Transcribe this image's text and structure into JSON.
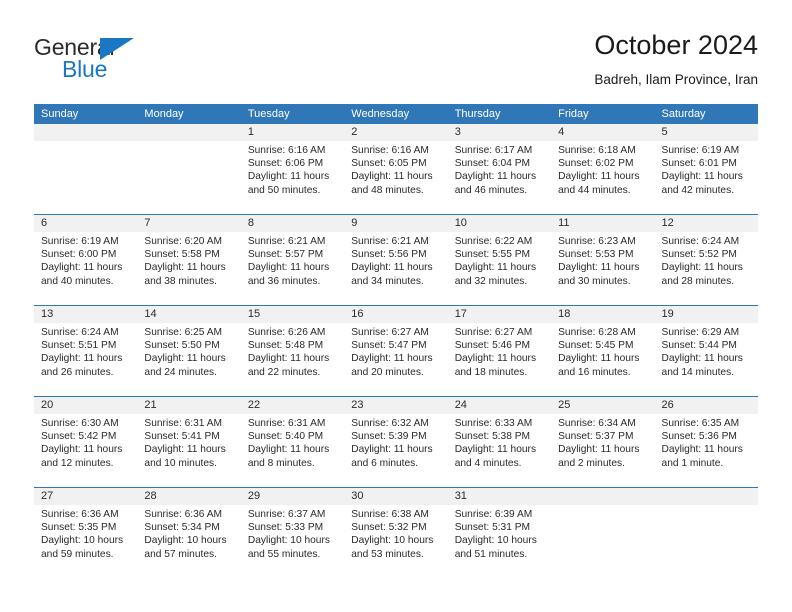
{
  "brand": {
    "name_top": "General",
    "name_bottom": "Blue",
    "accent_color": "#1b76c4"
  },
  "header": {
    "title": "October 2024",
    "subtitle": "Badreh, Ilam Province, Iran"
  },
  "theme": {
    "header_blue": "#3077b8",
    "daynum_band": "#f1f1f1",
    "text": "#2a2a2a"
  },
  "weekday_headers": [
    "Sunday",
    "Monday",
    "Tuesday",
    "Wednesday",
    "Thursday",
    "Friday",
    "Saturday"
  ],
  "weeks": [
    [
      {
        "day": "",
        "sunrise": "",
        "sunset": "",
        "daylight_1": "",
        "daylight_2": ""
      },
      {
        "day": "",
        "sunrise": "",
        "sunset": "",
        "daylight_1": "",
        "daylight_2": ""
      },
      {
        "day": "1",
        "sunrise": "Sunrise: 6:16 AM",
        "sunset": "Sunset: 6:06 PM",
        "daylight_1": "Daylight: 11 hours",
        "daylight_2": "and 50 minutes."
      },
      {
        "day": "2",
        "sunrise": "Sunrise: 6:16 AM",
        "sunset": "Sunset: 6:05 PM",
        "daylight_1": "Daylight: 11 hours",
        "daylight_2": "and 48 minutes."
      },
      {
        "day": "3",
        "sunrise": "Sunrise: 6:17 AM",
        "sunset": "Sunset: 6:04 PM",
        "daylight_1": "Daylight: 11 hours",
        "daylight_2": "and 46 minutes."
      },
      {
        "day": "4",
        "sunrise": "Sunrise: 6:18 AM",
        "sunset": "Sunset: 6:02 PM",
        "daylight_1": "Daylight: 11 hours",
        "daylight_2": "and 44 minutes."
      },
      {
        "day": "5",
        "sunrise": "Sunrise: 6:19 AM",
        "sunset": "Sunset: 6:01 PM",
        "daylight_1": "Daylight: 11 hours",
        "daylight_2": "and 42 minutes."
      }
    ],
    [
      {
        "day": "6",
        "sunrise": "Sunrise: 6:19 AM",
        "sunset": "Sunset: 6:00 PM",
        "daylight_1": "Daylight: 11 hours",
        "daylight_2": "and 40 minutes."
      },
      {
        "day": "7",
        "sunrise": "Sunrise: 6:20 AM",
        "sunset": "Sunset: 5:58 PM",
        "daylight_1": "Daylight: 11 hours",
        "daylight_2": "and 38 minutes."
      },
      {
        "day": "8",
        "sunrise": "Sunrise: 6:21 AM",
        "sunset": "Sunset: 5:57 PM",
        "daylight_1": "Daylight: 11 hours",
        "daylight_2": "and 36 minutes."
      },
      {
        "day": "9",
        "sunrise": "Sunrise: 6:21 AM",
        "sunset": "Sunset: 5:56 PM",
        "daylight_1": "Daylight: 11 hours",
        "daylight_2": "and 34 minutes."
      },
      {
        "day": "10",
        "sunrise": "Sunrise: 6:22 AM",
        "sunset": "Sunset: 5:55 PM",
        "daylight_1": "Daylight: 11 hours",
        "daylight_2": "and 32 minutes."
      },
      {
        "day": "11",
        "sunrise": "Sunrise: 6:23 AM",
        "sunset": "Sunset: 5:53 PM",
        "daylight_1": "Daylight: 11 hours",
        "daylight_2": "and 30 minutes."
      },
      {
        "day": "12",
        "sunrise": "Sunrise: 6:24 AM",
        "sunset": "Sunset: 5:52 PM",
        "daylight_1": "Daylight: 11 hours",
        "daylight_2": "and 28 minutes."
      }
    ],
    [
      {
        "day": "13",
        "sunrise": "Sunrise: 6:24 AM",
        "sunset": "Sunset: 5:51 PM",
        "daylight_1": "Daylight: 11 hours",
        "daylight_2": "and 26 minutes."
      },
      {
        "day": "14",
        "sunrise": "Sunrise: 6:25 AM",
        "sunset": "Sunset: 5:50 PM",
        "daylight_1": "Daylight: 11 hours",
        "daylight_2": "and 24 minutes."
      },
      {
        "day": "15",
        "sunrise": "Sunrise: 6:26 AM",
        "sunset": "Sunset: 5:48 PM",
        "daylight_1": "Daylight: 11 hours",
        "daylight_2": "and 22 minutes."
      },
      {
        "day": "16",
        "sunrise": "Sunrise: 6:27 AM",
        "sunset": "Sunset: 5:47 PM",
        "daylight_1": "Daylight: 11 hours",
        "daylight_2": "and 20 minutes."
      },
      {
        "day": "17",
        "sunrise": "Sunrise: 6:27 AM",
        "sunset": "Sunset: 5:46 PM",
        "daylight_1": "Daylight: 11 hours",
        "daylight_2": "and 18 minutes."
      },
      {
        "day": "18",
        "sunrise": "Sunrise: 6:28 AM",
        "sunset": "Sunset: 5:45 PM",
        "daylight_1": "Daylight: 11 hours",
        "daylight_2": "and 16 minutes."
      },
      {
        "day": "19",
        "sunrise": "Sunrise: 6:29 AM",
        "sunset": "Sunset: 5:44 PM",
        "daylight_1": "Daylight: 11 hours",
        "daylight_2": "and 14 minutes."
      }
    ],
    [
      {
        "day": "20",
        "sunrise": "Sunrise: 6:30 AM",
        "sunset": "Sunset: 5:42 PM",
        "daylight_1": "Daylight: 11 hours",
        "daylight_2": "and 12 minutes."
      },
      {
        "day": "21",
        "sunrise": "Sunrise: 6:31 AM",
        "sunset": "Sunset: 5:41 PM",
        "daylight_1": "Daylight: 11 hours",
        "daylight_2": "and 10 minutes."
      },
      {
        "day": "22",
        "sunrise": "Sunrise: 6:31 AM",
        "sunset": "Sunset: 5:40 PM",
        "daylight_1": "Daylight: 11 hours",
        "daylight_2": "and 8 minutes."
      },
      {
        "day": "23",
        "sunrise": "Sunrise: 6:32 AM",
        "sunset": "Sunset: 5:39 PM",
        "daylight_1": "Daylight: 11 hours",
        "daylight_2": "and 6 minutes."
      },
      {
        "day": "24",
        "sunrise": "Sunrise: 6:33 AM",
        "sunset": "Sunset: 5:38 PM",
        "daylight_1": "Daylight: 11 hours",
        "daylight_2": "and 4 minutes."
      },
      {
        "day": "25",
        "sunrise": "Sunrise: 6:34 AM",
        "sunset": "Sunset: 5:37 PM",
        "daylight_1": "Daylight: 11 hours",
        "daylight_2": "and 2 minutes."
      },
      {
        "day": "26",
        "sunrise": "Sunrise: 6:35 AM",
        "sunset": "Sunset: 5:36 PM",
        "daylight_1": "Daylight: 11 hours",
        "daylight_2": "and 1 minute."
      }
    ],
    [
      {
        "day": "27",
        "sunrise": "Sunrise: 6:36 AM",
        "sunset": "Sunset: 5:35 PM",
        "daylight_1": "Daylight: 10 hours",
        "daylight_2": "and 59 minutes."
      },
      {
        "day": "28",
        "sunrise": "Sunrise: 6:36 AM",
        "sunset": "Sunset: 5:34 PM",
        "daylight_1": "Daylight: 10 hours",
        "daylight_2": "and 57 minutes."
      },
      {
        "day": "29",
        "sunrise": "Sunrise: 6:37 AM",
        "sunset": "Sunset: 5:33 PM",
        "daylight_1": "Daylight: 10 hours",
        "daylight_2": "and 55 minutes."
      },
      {
        "day": "30",
        "sunrise": "Sunrise: 6:38 AM",
        "sunset": "Sunset: 5:32 PM",
        "daylight_1": "Daylight: 10 hours",
        "daylight_2": "and 53 minutes."
      },
      {
        "day": "31",
        "sunrise": "Sunrise: 6:39 AM",
        "sunset": "Sunset: 5:31 PM",
        "daylight_1": "Daylight: 10 hours",
        "daylight_2": "and 51 minutes."
      },
      {
        "day": "",
        "sunrise": "",
        "sunset": "",
        "daylight_1": "",
        "daylight_2": ""
      },
      {
        "day": "",
        "sunrise": "",
        "sunset": "",
        "daylight_1": "",
        "daylight_2": ""
      }
    ]
  ]
}
